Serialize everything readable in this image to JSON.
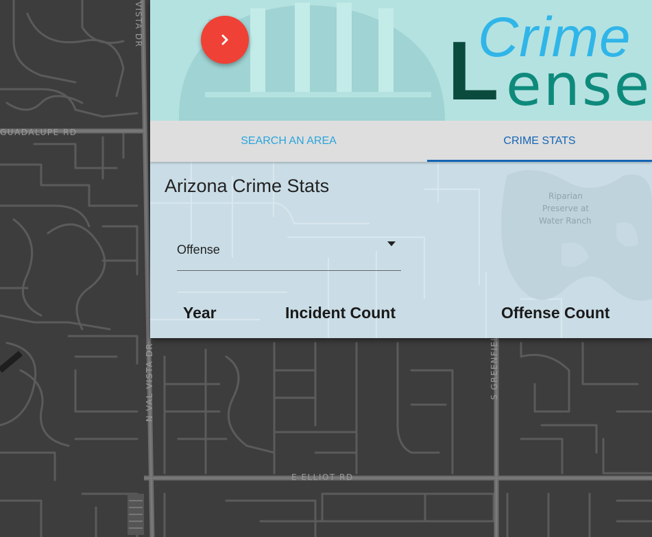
{
  "map": {
    "roads": [
      "GUADALUPE RD",
      "VISTA DR",
      "N VAL VISTA DR",
      "E ELLIOT RD",
      "S GREENFIELD RD"
    ],
    "park_label": [
      "Riparian",
      "Preserve at",
      "Water Ranch"
    ]
  },
  "header": {
    "toggle_icon": "chevron-right-icon",
    "logo_crime": "Crime",
    "logo_L": "L",
    "logo_ense": "ense"
  },
  "tabs": [
    {
      "label": "SEARCH AN AREA",
      "active": false
    },
    {
      "label": "CRIME STATS",
      "active": true
    }
  ],
  "stats": {
    "title": "Arizona Crime Stats",
    "select_value": "Offense",
    "columns": [
      "Year",
      "Incident Count",
      "Offense Count"
    ]
  },
  "colors": {
    "accent_red": "#ef4135",
    "header_bg": "#b4e2e0",
    "logo_blue": "#30b5e8",
    "logo_dark_green": "#0b4b3d",
    "logo_teal": "#0e8a7c",
    "tab_active": "#1565b4",
    "tab_inactive": "#2aa4dc"
  }
}
